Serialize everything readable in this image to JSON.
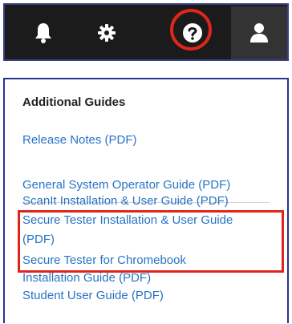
{
  "toolbar": {
    "icons": [
      "bell-icon",
      "gear-icon",
      "help-circle-icon",
      "user-icon"
    ],
    "colors": {
      "background": "#1b1b1b",
      "icon": "#ffffff",
      "active_bg": "#333333",
      "highlight": "#e0261c"
    }
  },
  "panel": {
    "heading": "Additional Guides",
    "links": [
      "Release Notes (PDF)",
      "General System Operator Guide (PDF)",
      "ScanIt Installation & User Guide (PDF)",
      "Secure Tester Installation & User Guide",
      "(PDF)",
      "Secure Tester for Chromebook",
      "Installation Guide (PDF)",
      "Student User Guide (PDF)"
    ],
    "colors": {
      "link": "#2873c4",
      "heading": "#222222",
      "border": "#2c3290"
    }
  }
}
